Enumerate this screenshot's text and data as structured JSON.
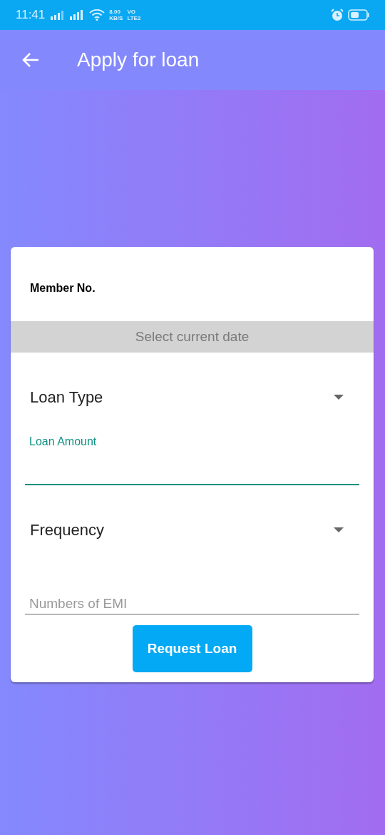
{
  "status_bar": {
    "time": "11:41",
    "speed_value": "8.00",
    "speed_unit": "KB/S",
    "volte_top": "VO",
    "volte_bottom": "LTE2"
  },
  "app_bar": {
    "title": "Apply for loan"
  },
  "form": {
    "member_label": "Member No.",
    "date_button": "Select current date",
    "fields": [
      {
        "kind": "dropdown",
        "label": "Loan Type"
      },
      {
        "kind": "text",
        "label": "Loan Amount",
        "focused": true
      },
      {
        "kind": "dropdown",
        "label": "Frequency"
      },
      {
        "kind": "text",
        "placeholder": "Numbers of EMI",
        "focused": false
      }
    ],
    "submit": "Request Loan"
  }
}
